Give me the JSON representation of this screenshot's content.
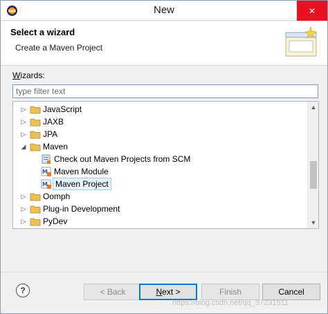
{
  "window": {
    "title": "New",
    "close_glyph": "✕"
  },
  "banner": {
    "title": "Select a wizard",
    "description": "Create a Maven Project"
  },
  "wizards": {
    "label_prefix": "W",
    "label_rest": "izards:",
    "filter_placeholder": "type filter text"
  },
  "tree": {
    "items": [
      {
        "label": "JavaScript",
        "icon": "folder-icon",
        "expanded": false
      },
      {
        "label": "JAXB",
        "icon": "folder-icon",
        "expanded": false
      },
      {
        "label": "JPA",
        "icon": "folder-icon",
        "expanded": false
      },
      {
        "label": "Maven",
        "icon": "folder-icon",
        "expanded": true
      },
      {
        "label": "Check out Maven Projects from SCM",
        "icon": "checkout-icon",
        "child": true
      },
      {
        "label": "Maven Module",
        "icon": "maven-module-icon",
        "child": true
      },
      {
        "label": "Maven Project",
        "icon": "maven-project-icon",
        "child": true,
        "selected": true
      },
      {
        "label": "Oomph",
        "icon": "folder-icon",
        "expanded": false
      },
      {
        "label": "Plug-in Development",
        "icon": "folder-icon",
        "expanded": false
      },
      {
        "label": "PyDev",
        "icon": "folder-icon",
        "expanded": false
      }
    ]
  },
  "buttons": {
    "help": "?",
    "back": "< Back",
    "next": "Next >",
    "finish": "Finish",
    "cancel": "Cancel"
  },
  "watermark": "https://blog.csdn.net/qq_37231511",
  "colors": {
    "selection_bg": "#e5f1fb",
    "selection_border": "#99d1ff",
    "close_red": "#e81123",
    "folder": "#e8c15a"
  }
}
